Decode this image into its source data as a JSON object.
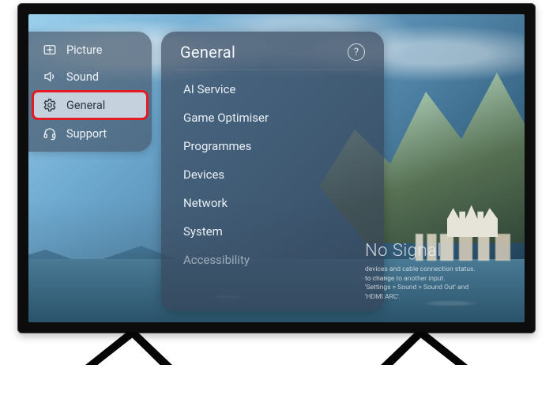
{
  "sidebar": {
    "items": [
      {
        "id": "picture",
        "label": "Picture",
        "icon": "picture-icon",
        "selected": false,
        "highlighted": false
      },
      {
        "id": "sound",
        "label": "Sound",
        "icon": "sound-icon",
        "selected": false,
        "highlighted": false
      },
      {
        "id": "general",
        "label": "General",
        "icon": "gear-icon",
        "selected": true,
        "highlighted": true
      },
      {
        "id": "support",
        "label": "Support",
        "icon": "headset-icon",
        "selected": false,
        "highlighted": false
      }
    ]
  },
  "submenu": {
    "title": "General",
    "help_label": "?",
    "items": [
      {
        "label": "AI Service"
      },
      {
        "label": "Game Optimiser"
      },
      {
        "label": "Programmes"
      },
      {
        "label": "Devices"
      },
      {
        "label": "Network"
      },
      {
        "label": "System"
      },
      {
        "label": "Accessibility",
        "faded": true
      }
    ]
  },
  "nosignal": {
    "title": "No Signal",
    "line1": "devices and cable connection status.",
    "line2": "to change to another input.",
    "line3": "'Settings > Sound > Sound Out' and",
    "line4": "'HDMI ARC'."
  },
  "colors": {
    "highlight_red": "#e31b23",
    "panel_tint": "rgba(60,75,95,0.68)",
    "text_light": "#eef3f8"
  }
}
